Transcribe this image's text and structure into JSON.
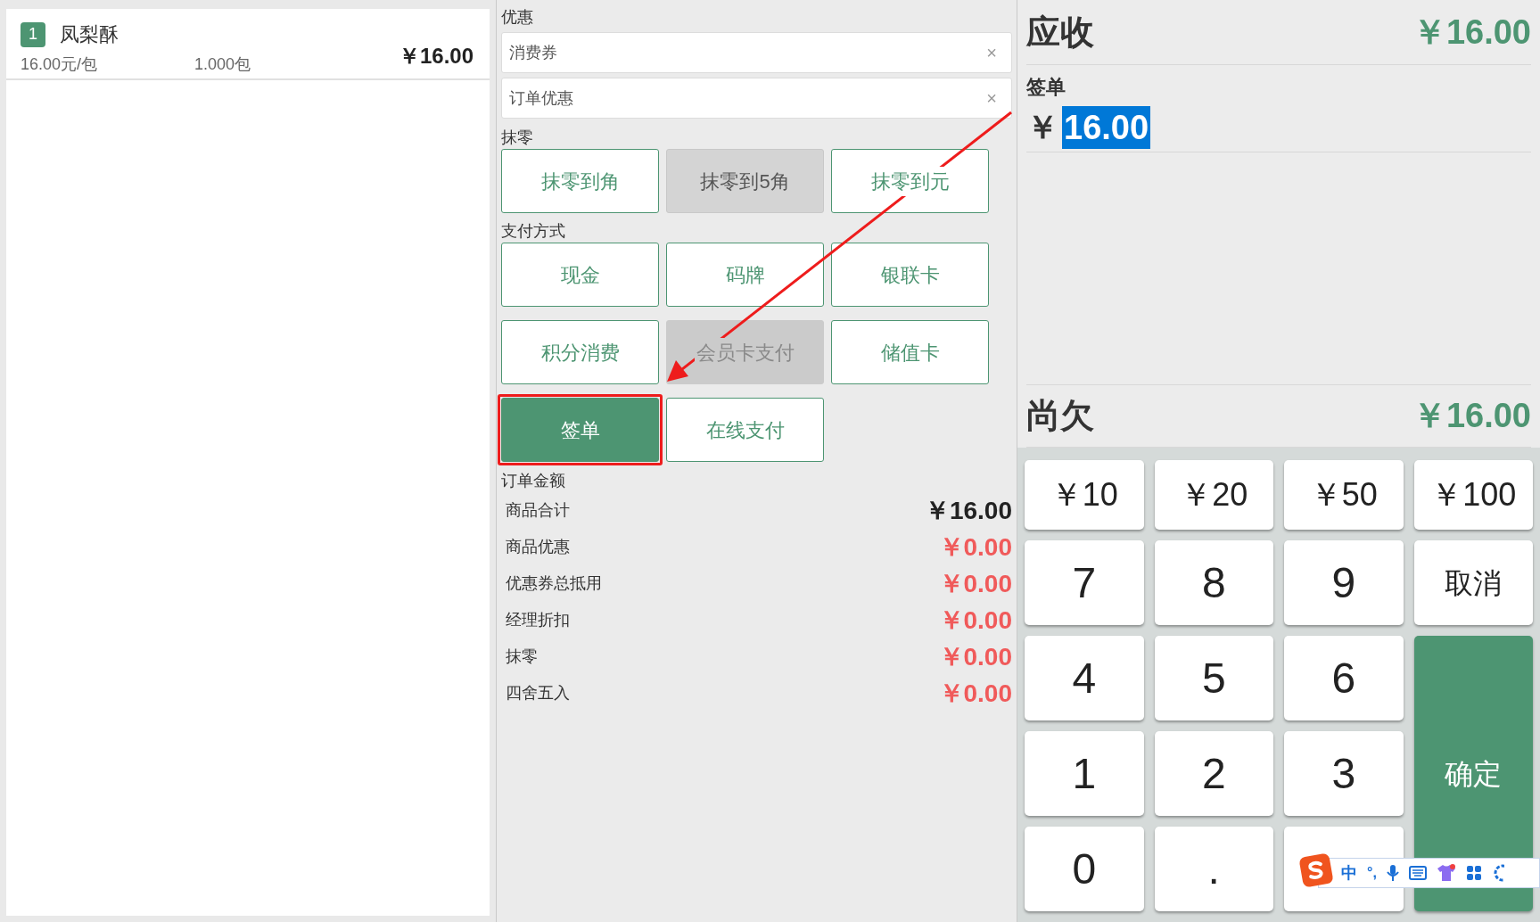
{
  "order_items": [
    {
      "index": "1",
      "name": "凤梨酥",
      "unit_price": "16.00元/包",
      "quantity": "1.000包",
      "amount": "￥16.00"
    }
  ],
  "discounts": {
    "label": "优惠",
    "fields": [
      {
        "placeholder": "消费券",
        "clear": "×"
      },
      {
        "placeholder": "订单优惠",
        "clear": "×"
      }
    ]
  },
  "rounding": {
    "label": "抹零",
    "options": [
      {
        "label": "抹零到角",
        "selected": false
      },
      {
        "label": "抹零到5角",
        "selected": true
      },
      {
        "label": "抹零到元",
        "selected": false
      }
    ]
  },
  "payment": {
    "label": "支付方式",
    "methods": [
      {
        "label": "现金",
        "selected": false,
        "disabled": false
      },
      {
        "label": "码牌",
        "selected": false,
        "disabled": false
      },
      {
        "label": "银联卡",
        "selected": false,
        "disabled": false
      },
      {
        "label": "积分消费",
        "selected": false,
        "disabled": false
      },
      {
        "label": "会员卡支付",
        "selected": false,
        "disabled": true
      },
      {
        "label": "储值卡",
        "selected": false,
        "disabled": false
      },
      {
        "label": "签单",
        "selected": true,
        "disabled": false
      },
      {
        "label": "在线支付",
        "selected": false,
        "disabled": false
      }
    ]
  },
  "order_amount": {
    "label": "订单金额",
    "rows": [
      {
        "label": "商品合计",
        "value": "￥16.00",
        "kind": "total"
      },
      {
        "label": "商品优惠",
        "value": "￥0.00",
        "kind": "deduction"
      },
      {
        "label": "优惠券总抵用",
        "value": "￥0.00",
        "kind": "deduction"
      },
      {
        "label": "经理折扣",
        "value": "￥0.00",
        "kind": "deduction"
      },
      {
        "label": "抹零",
        "value": "￥0.00",
        "kind": "deduction"
      },
      {
        "label": "四舍五入",
        "value": "￥0.00",
        "kind": "deduction"
      }
    ]
  },
  "receivable": {
    "label": "应收",
    "value": "￥16.00"
  },
  "payment_entry": {
    "label": "签单",
    "currency": "￥",
    "value": "16.00"
  },
  "outstanding": {
    "label": "尚欠",
    "value": "￥16.00"
  },
  "keypad": [
    {
      "label": "￥10",
      "kind": "quick"
    },
    {
      "label": "￥20",
      "kind": "quick"
    },
    {
      "label": "￥50",
      "kind": "quick"
    },
    {
      "label": "￥100",
      "kind": "quick"
    },
    {
      "label": "7",
      "kind": "digit"
    },
    {
      "label": "8",
      "kind": "digit"
    },
    {
      "label": "9",
      "kind": "digit"
    },
    {
      "label": "取消",
      "kind": "action"
    },
    {
      "label": "4",
      "kind": "digit"
    },
    {
      "label": "5",
      "kind": "digit"
    },
    {
      "label": "6",
      "kind": "digit"
    },
    {
      "label": "1",
      "kind": "digit"
    },
    {
      "label": "2",
      "kind": "digit"
    },
    {
      "label": "3",
      "kind": "digit"
    },
    {
      "label": "确定",
      "kind": "confirm"
    },
    {
      "label": "0",
      "kind": "digit"
    },
    {
      "label": ".",
      "kind": "digit"
    },
    {
      "kind": "action"
    }
  ],
  "ime_toolbar": {
    "mode": "中",
    "punctuation": "°,"
  }
}
